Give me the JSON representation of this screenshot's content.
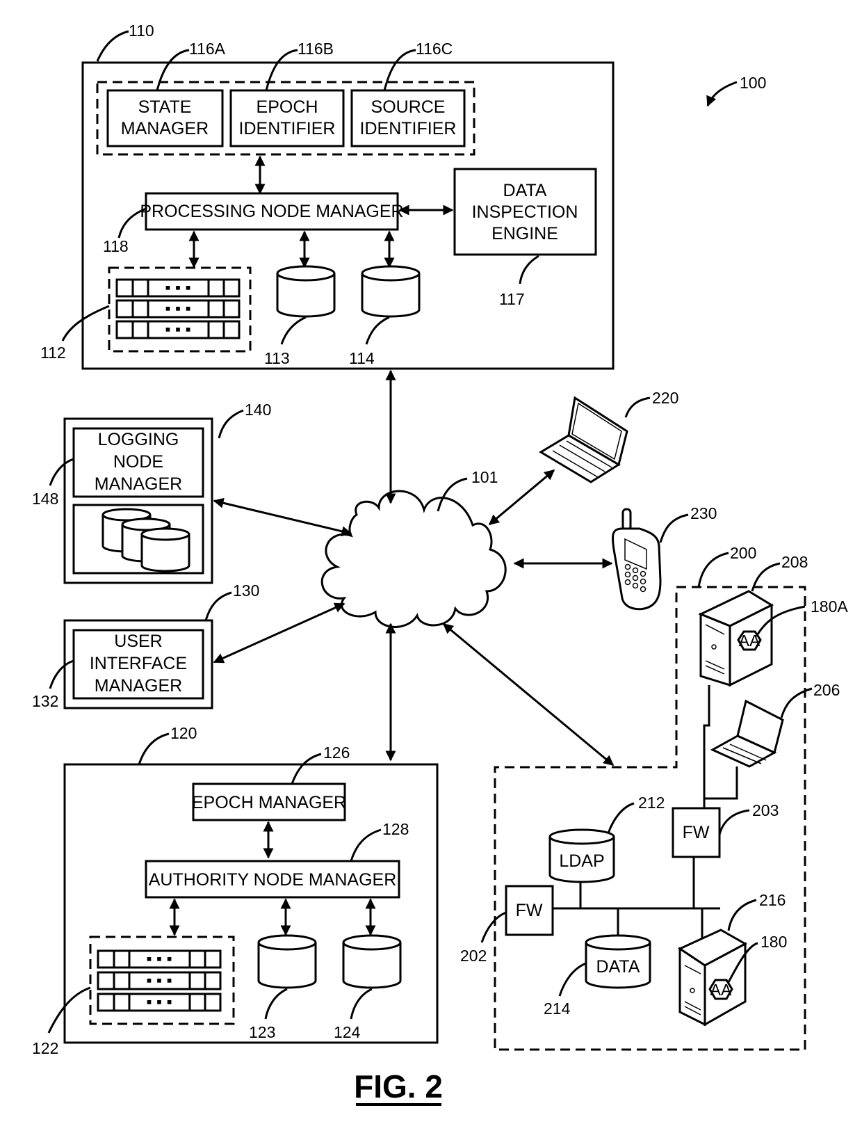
{
  "figure": {
    "title": "FIG. 2",
    "system_ref": "100"
  },
  "processing_node": {
    "ref": "110",
    "state_manager": {
      "ref": "116A",
      "line1": "STATE",
      "line2": "MANAGER"
    },
    "epoch_identifier": {
      "ref": "116B",
      "line1": "EPOCH",
      "line2": "IDENTIFIER"
    },
    "source_identifier": {
      "ref": "116C",
      "line1": "SOURCE",
      "line2": "IDENTIFIER"
    },
    "manager": {
      "ref": "118",
      "label": "PROCESSING NODE MANAGER"
    },
    "inspection_engine": {
      "ref": "117",
      "line1": "DATA",
      "line2": "INSPECTION",
      "line3": "ENGINE"
    },
    "server_rack": {
      "ref": "112",
      "dots": "▪ ▪ ▪"
    },
    "db1": {
      "ref": "113"
    },
    "db2": {
      "ref": "114"
    }
  },
  "logging_node": {
    "ref": "140",
    "manager": {
      "ref": "148",
      "line1": "LOGGING",
      "line2": "NODE",
      "line3": "MANAGER"
    }
  },
  "ui_node": {
    "ref": "130",
    "manager": {
      "ref": "132",
      "line1": "USER",
      "line2": "INTERFACE",
      "line3": "MANAGER"
    }
  },
  "authority_node": {
    "ref": "120",
    "epoch_manager": {
      "ref": "126",
      "label": "EPOCH MANAGER"
    },
    "manager": {
      "ref": "128",
      "label": "AUTHORITY NODE MANAGER"
    },
    "server_rack": {
      "ref": "122",
      "dots": "▪ ▪ ▪"
    },
    "db1": {
      "ref": "123"
    },
    "db2": {
      "ref": "124"
    }
  },
  "network": {
    "ref": "101"
  },
  "laptop": {
    "ref": "220"
  },
  "phone": {
    "ref": "230"
  },
  "enterprise": {
    "ref": "200",
    "server_top": {
      "ref": "208",
      "agent_ref": "180A",
      "agent_label": "AA"
    },
    "laptop": {
      "ref": "206"
    },
    "firewall_right": {
      "ref": "203",
      "label": "FW"
    },
    "firewall_left": {
      "ref": "202",
      "label": "FW"
    },
    "ldap": {
      "ref": "212",
      "label": "LDAP"
    },
    "data": {
      "ref": "214",
      "label": "DATA"
    },
    "server_bottom": {
      "ref": "216",
      "agent_ref": "180",
      "agent_label": "AA"
    }
  }
}
